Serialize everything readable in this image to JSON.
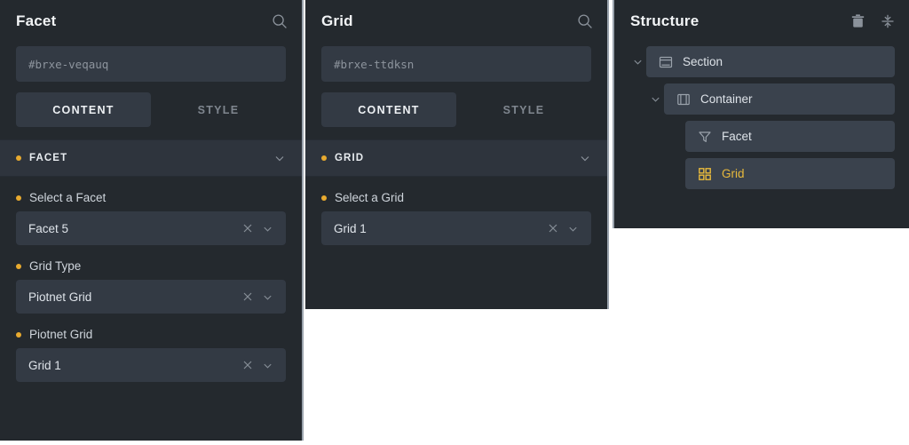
{
  "theme": {
    "panel_bg": "#24292e",
    "field_bg": "#333a44",
    "accordion_bg": "#2e343d",
    "tree_item_bg": "#3a424d",
    "accent": "#e8aa2f",
    "selected_text": "#e8b93c",
    "text_primary": "#e9edf1",
    "text_muted": "#8b929b",
    "divider": "#9aa3ad"
  },
  "facet_panel": {
    "title": "Facet",
    "search_icon": "search-icon",
    "id_field": {
      "value": "",
      "placeholder": "#brxe-veqauq"
    },
    "tabs": [
      {
        "label": "CONTENT",
        "active": true
      },
      {
        "label": "STYLE",
        "active": false
      }
    ],
    "accordion": {
      "title": "FACET",
      "chevron": "chevron-down-icon",
      "expanded": true
    },
    "fields": [
      {
        "label": "Select a Facet",
        "value": "Facet 5",
        "clear_icon": "close-icon",
        "chevron_icon": "chevron-down-icon"
      },
      {
        "label": "Grid Type",
        "value": "Piotnet Grid",
        "clear_icon": "close-icon",
        "chevron_icon": "chevron-down-icon"
      },
      {
        "label": "Piotnet Grid",
        "value": "Grid 1",
        "clear_icon": "close-icon",
        "chevron_icon": "chevron-down-icon"
      }
    ]
  },
  "grid_panel": {
    "title": "Grid",
    "search_icon": "search-icon",
    "id_field": {
      "value": "",
      "placeholder": "#brxe-ttdksn"
    },
    "tabs": [
      {
        "label": "CONTENT",
        "active": true
      },
      {
        "label": "STYLE",
        "active": false
      }
    ],
    "accordion": {
      "title": "GRID",
      "chevron": "chevron-down-icon",
      "expanded": true
    },
    "fields": [
      {
        "label": "Select a Grid",
        "value": "Grid 1",
        "clear_icon": "close-icon",
        "chevron_icon": "chevron-down-icon"
      }
    ]
  },
  "structure_panel": {
    "title": "Structure",
    "actions": [
      {
        "name": "delete-icon",
        "title": "Delete"
      },
      {
        "name": "collapse-all-icon",
        "title": "Collapse"
      }
    ],
    "tree": [
      {
        "label": "Section",
        "icon": "section-icon",
        "depth": 0,
        "has_caret": true,
        "expanded": true,
        "selected": false
      },
      {
        "label": "Container",
        "icon": "container-icon",
        "depth": 1,
        "has_caret": true,
        "expanded": true,
        "selected": false
      },
      {
        "label": "Facet",
        "icon": "funnel-icon",
        "depth": 2,
        "has_caret": false,
        "expanded": false,
        "selected": false
      },
      {
        "label": "Grid",
        "icon": "grid-icon",
        "depth": 2,
        "has_caret": false,
        "expanded": false,
        "selected": true
      }
    ]
  }
}
